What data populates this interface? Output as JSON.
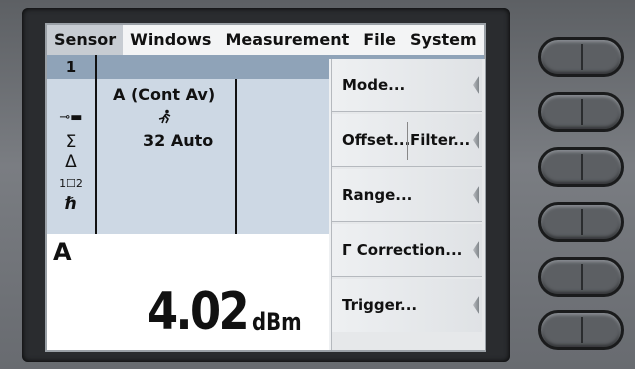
{
  "menu": {
    "items": [
      "Sensor",
      "Windows",
      "Measurement",
      "File",
      "System"
    ],
    "active_index": 0
  },
  "channel": {
    "number": "1"
  },
  "status_icons": [
    {
      "name": "sensor-connector-icon",
      "glyph": "⊸▬"
    },
    {
      "name": "sigma-icon",
      "glyph": "Σ"
    },
    {
      "name": "delta-icon",
      "glyph": "Δ"
    },
    {
      "name": "window-1-2-icon",
      "glyph": "1☐2"
    },
    {
      "name": "trigger-hold-icon",
      "glyph": "ℏ"
    }
  ],
  "sensor": {
    "label": "A (Cont Av)",
    "run_icon": "🏃",
    "averaging": "32  Auto"
  },
  "display": {
    "channel_letter": "A",
    "reading": "4.02",
    "unit": "dBm"
  },
  "softkeys": [
    {
      "label": "Mode..."
    },
    {
      "label": "Offset...",
      "label_right": "Filter..."
    },
    {
      "label": "Range..."
    },
    {
      "label": "Γ Correction..."
    },
    {
      "label": "Trigger..."
    }
  ]
}
